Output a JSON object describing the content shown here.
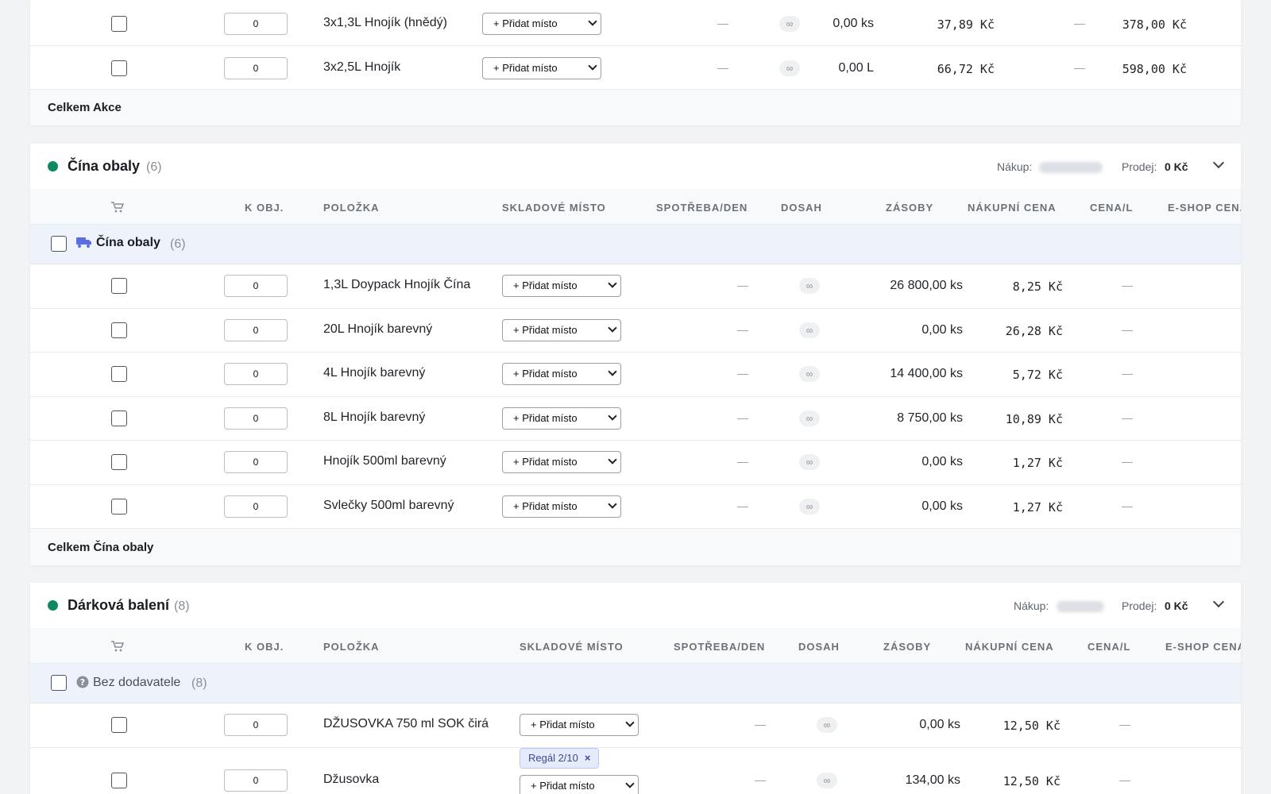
{
  "common": {
    "qty_value": "0",
    "add_place": "+ Přidat místo",
    "dash": "—",
    "infinity": "∞"
  },
  "akce": {
    "rows": [
      {
        "item": "3x1,3L Hnojík (hnědý)",
        "stock": "0,00 ks",
        "price": "37,89 Kč",
        "cena_l": "—",
        "eshop": "378,00 Kč"
      },
      {
        "item": "3x2,5L Hnojík",
        "stock": "0,00 L",
        "price": "66,72 Kč",
        "cena_l": "—",
        "eshop": "598,00 Kč"
      }
    ],
    "total_label": "Celkem Akce"
  },
  "cina": {
    "title": "Čína obaly",
    "count": "(6)",
    "nakup_label": "Nákup:",
    "prodej_label": "Prodej:",
    "prodej_value": "0 Kč",
    "headers": [
      "K OBJ.",
      "POLOŽKA",
      "SKLADOVÉ MÍSTO",
      "SPOTŘEBA/DEN",
      "DOSAH",
      "ZÁSOBY",
      "NÁKUPNÍ CENA",
      "CENA/L",
      "E-SHOP CENA"
    ],
    "group_name": "Čína obaly",
    "group_count": "(6)",
    "rows": [
      {
        "item": "1,3L Doypack Hnojík Čína",
        "stock": "26 800,00 ks",
        "price": "8,25 Kč",
        "cena_l": "—"
      },
      {
        "item": "20L Hnojík barevný",
        "stock": "0,00 ks",
        "price": "26,28 Kč",
        "cena_l": "—"
      },
      {
        "item": "4L Hnojík barevný",
        "stock": "14 400,00 ks",
        "price": "5,72 Kč",
        "cena_l": "—"
      },
      {
        "item": "8L Hnojík barevný",
        "stock": "8 750,00 ks",
        "price": "10,89 Kč",
        "cena_l": "—"
      },
      {
        "item": "Hnojík 500ml barevný",
        "stock": "0,00 ks",
        "price": "1,27 Kč",
        "cena_l": "—"
      },
      {
        "item": "Svlečky 500ml barevný",
        "stock": "0,00 ks",
        "price": "1,27 Kč",
        "cena_l": "—"
      }
    ],
    "total_label": "Celkem Čína obaly"
  },
  "darkova": {
    "title": "Dárková balení",
    "count": "(8)",
    "nakup_label": "Nákup:",
    "prodej_label": "Prodej:",
    "prodej_value": "0 Kč",
    "headers": [
      "K OBJ.",
      "POLOŽKA",
      "SKLADOVÉ MÍSTO",
      "SPOTŘEBA/DEN",
      "DOSAH",
      "ZÁSOBY",
      "NÁKUPNÍ CENA",
      "CENA/L",
      "E-SHOP CENA"
    ],
    "group_name": "Bez dodavatele",
    "group_count": "(8)",
    "rows": [
      {
        "item": "DŽUSOVKA 750 ml SOK čirá",
        "stock": "0,00 ks",
        "price": "12,50 Kč",
        "cena_l": "—"
      },
      {
        "item": "Džusovka",
        "stock": "134,00 ks",
        "price": "12,50 Kč",
        "cena_l": "—",
        "badge": "Regál 2/10"
      }
    ]
  }
}
